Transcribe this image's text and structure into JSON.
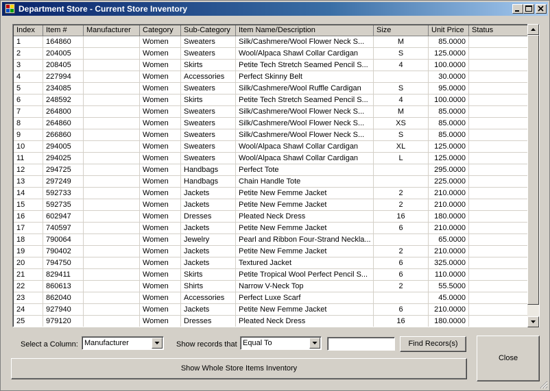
{
  "window": {
    "title": "Department Store - Current Store Inventory",
    "controls": {
      "minimize": "_",
      "maximize": "□",
      "close": "✕"
    }
  },
  "grid": {
    "columns": [
      "Index",
      "Item #",
      "Manufacturer",
      "Category",
      "Sub-Category",
      "Item Name/Description",
      "Size",
      "Unit Price",
      "Status"
    ],
    "rows": [
      [
        "1",
        "164860",
        "",
        "Women",
        "Sweaters",
        "Silk/Cashmere/Wool Flower Neck S...",
        "M",
        "85.0000",
        ""
      ],
      [
        "2",
        "204005",
        "",
        "Women",
        "Sweaters",
        "Wool/Alpaca Shawl Collar Cardigan",
        "S",
        "125.0000",
        ""
      ],
      [
        "3",
        "208405",
        "",
        "Women",
        "Skirts",
        "Petite Tech Stretch Seamed Pencil S...",
        "4",
        "100.0000",
        ""
      ],
      [
        "4",
        "227994",
        "",
        "Women",
        "Accessories",
        "Perfect Skinny Belt",
        "",
        "30.0000",
        ""
      ],
      [
        "5",
        "234085",
        "",
        "Women",
        "Sweaters",
        "Silk/Cashmere/Wool Ruffle Cardigan",
        "S",
        "95.0000",
        ""
      ],
      [
        "6",
        "248592",
        "",
        "Women",
        "Skirts",
        "Petite Tech Stretch Seamed Pencil S...",
        "4",
        "100.0000",
        ""
      ],
      [
        "7",
        "264800",
        "",
        "Women",
        "Sweaters",
        "Silk/Cashmere/Wool Flower Neck S...",
        "M",
        "85.0000",
        ""
      ],
      [
        "8",
        "264860",
        "",
        "Women",
        "Sweaters",
        "Silk/Cashmere/Wool Flower Neck S...",
        "XS",
        "85.0000",
        ""
      ],
      [
        "9",
        "266860",
        "",
        "Women",
        "Sweaters",
        "Silk/Cashmere/Wool Flower Neck S...",
        "S",
        "85.0000",
        ""
      ],
      [
        "10",
        "294005",
        "",
        "Women",
        "Sweaters",
        "Wool/Alpaca Shawl Collar Cardigan",
        "XL",
        "125.0000",
        ""
      ],
      [
        "11",
        "294025",
        "",
        "Women",
        "Sweaters",
        "Wool/Alpaca Shawl Collar Cardigan",
        "L",
        "125.0000",
        ""
      ],
      [
        "12",
        "294725",
        "",
        "Women",
        "Handbags",
        "Perfect Tote",
        "",
        "295.0000",
        ""
      ],
      [
        "13",
        "297249",
        "",
        "Women",
        "Handbags",
        "Chain Handle Tote",
        "",
        "225.0000",
        ""
      ],
      [
        "14",
        "592733",
        "",
        "Women",
        "Jackets",
        "Petite New Femme Jacket",
        "2",
        "210.0000",
        ""
      ],
      [
        "15",
        "592735",
        "",
        "Women",
        "Jackets",
        "Petite New Femme Jacket",
        "2",
        "210.0000",
        ""
      ],
      [
        "16",
        "602947",
        "",
        "Women",
        "Dresses",
        "Pleated Neck Dress",
        "16",
        "180.0000",
        ""
      ],
      [
        "17",
        "740597",
        "",
        "Women",
        "Jackets",
        "Petite New Femme Jacket",
        "6",
        "210.0000",
        ""
      ],
      [
        "18",
        "790064",
        "",
        "Women",
        "Jewelry",
        "Pearl and Ribbon Four-Strand Neckla...",
        "",
        "65.0000",
        ""
      ],
      [
        "19",
        "790402",
        "",
        "Women",
        "Jackets",
        "Petite New Femme Jacket",
        "2",
        "210.0000",
        ""
      ],
      [
        "20",
        "794750",
        "",
        "Women",
        "Jackets",
        "Textured Jacket",
        "6",
        "325.0000",
        ""
      ],
      [
        "21",
        "829411",
        "",
        "Women",
        "Skirts",
        "Petite Tropical Wool Perfect Pencil S...",
        "6",
        "110.0000",
        ""
      ],
      [
        "22",
        "860613",
        "",
        "Women",
        "Shirts",
        "Narrow V-Neck Top",
        "2",
        "55.5000",
        ""
      ],
      [
        "23",
        "862040",
        "",
        "Women",
        "Accessories",
        "Perfect Luxe Scarf",
        "",
        "45.0000",
        ""
      ],
      [
        "24",
        "927940",
        "",
        "Women",
        "Jackets",
        "Petite New Femme Jacket",
        "6",
        "210.0000",
        ""
      ],
      [
        "25",
        "979120",
        "",
        "Women",
        "Dresses",
        "Pleated Neck Dress",
        "16",
        "180.0000",
        ""
      ]
    ]
  },
  "filters": {
    "select_column_label": "Select a Column:",
    "selected_column": "Manufacturer",
    "show_records_label": "Show records that",
    "operator": "Equal To",
    "value": "",
    "find_button": "Find Recors(s)"
  },
  "buttons": {
    "show_whole": "Show Whole Store Items Inventory",
    "close": "Close"
  }
}
